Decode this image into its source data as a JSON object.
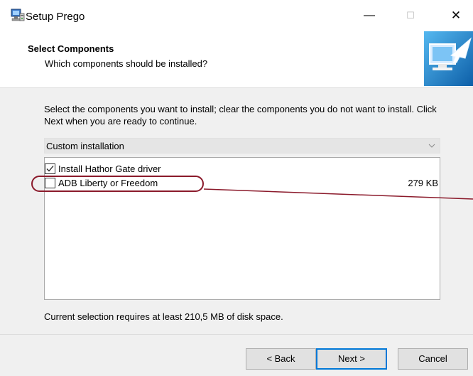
{
  "window": {
    "title": "Setup Prego",
    "minimize_glyph": "—",
    "maximize_glyph": "☐",
    "close_glyph": "✕"
  },
  "header": {
    "title": "Select Components",
    "subtitle": "Which components should be installed?"
  },
  "body": {
    "intro": "Select the components you want to install; clear the components you do not want to install. Click Next when you are ready to continue.",
    "install_type": {
      "selected": "Custom installation"
    },
    "components": [
      {
        "label": "Install Hathor Gate driver",
        "checked": true,
        "size": ""
      },
      {
        "label": "ADB Liberty or Freedom",
        "checked": false,
        "size": "279 KB"
      }
    ],
    "requirement": "Current selection requires at least 210,5 MB of disk space."
  },
  "footer": {
    "back_label": "< Back",
    "next_label": "Next >",
    "cancel_label": "Cancel"
  },
  "colors": {
    "accent": "#0078d7",
    "annotation": "#8b1a2b",
    "panel_bg": "#f0f0f0"
  },
  "icons": {
    "app": "installer-computer-icon",
    "wizard": "monitor-arrow-icon"
  }
}
